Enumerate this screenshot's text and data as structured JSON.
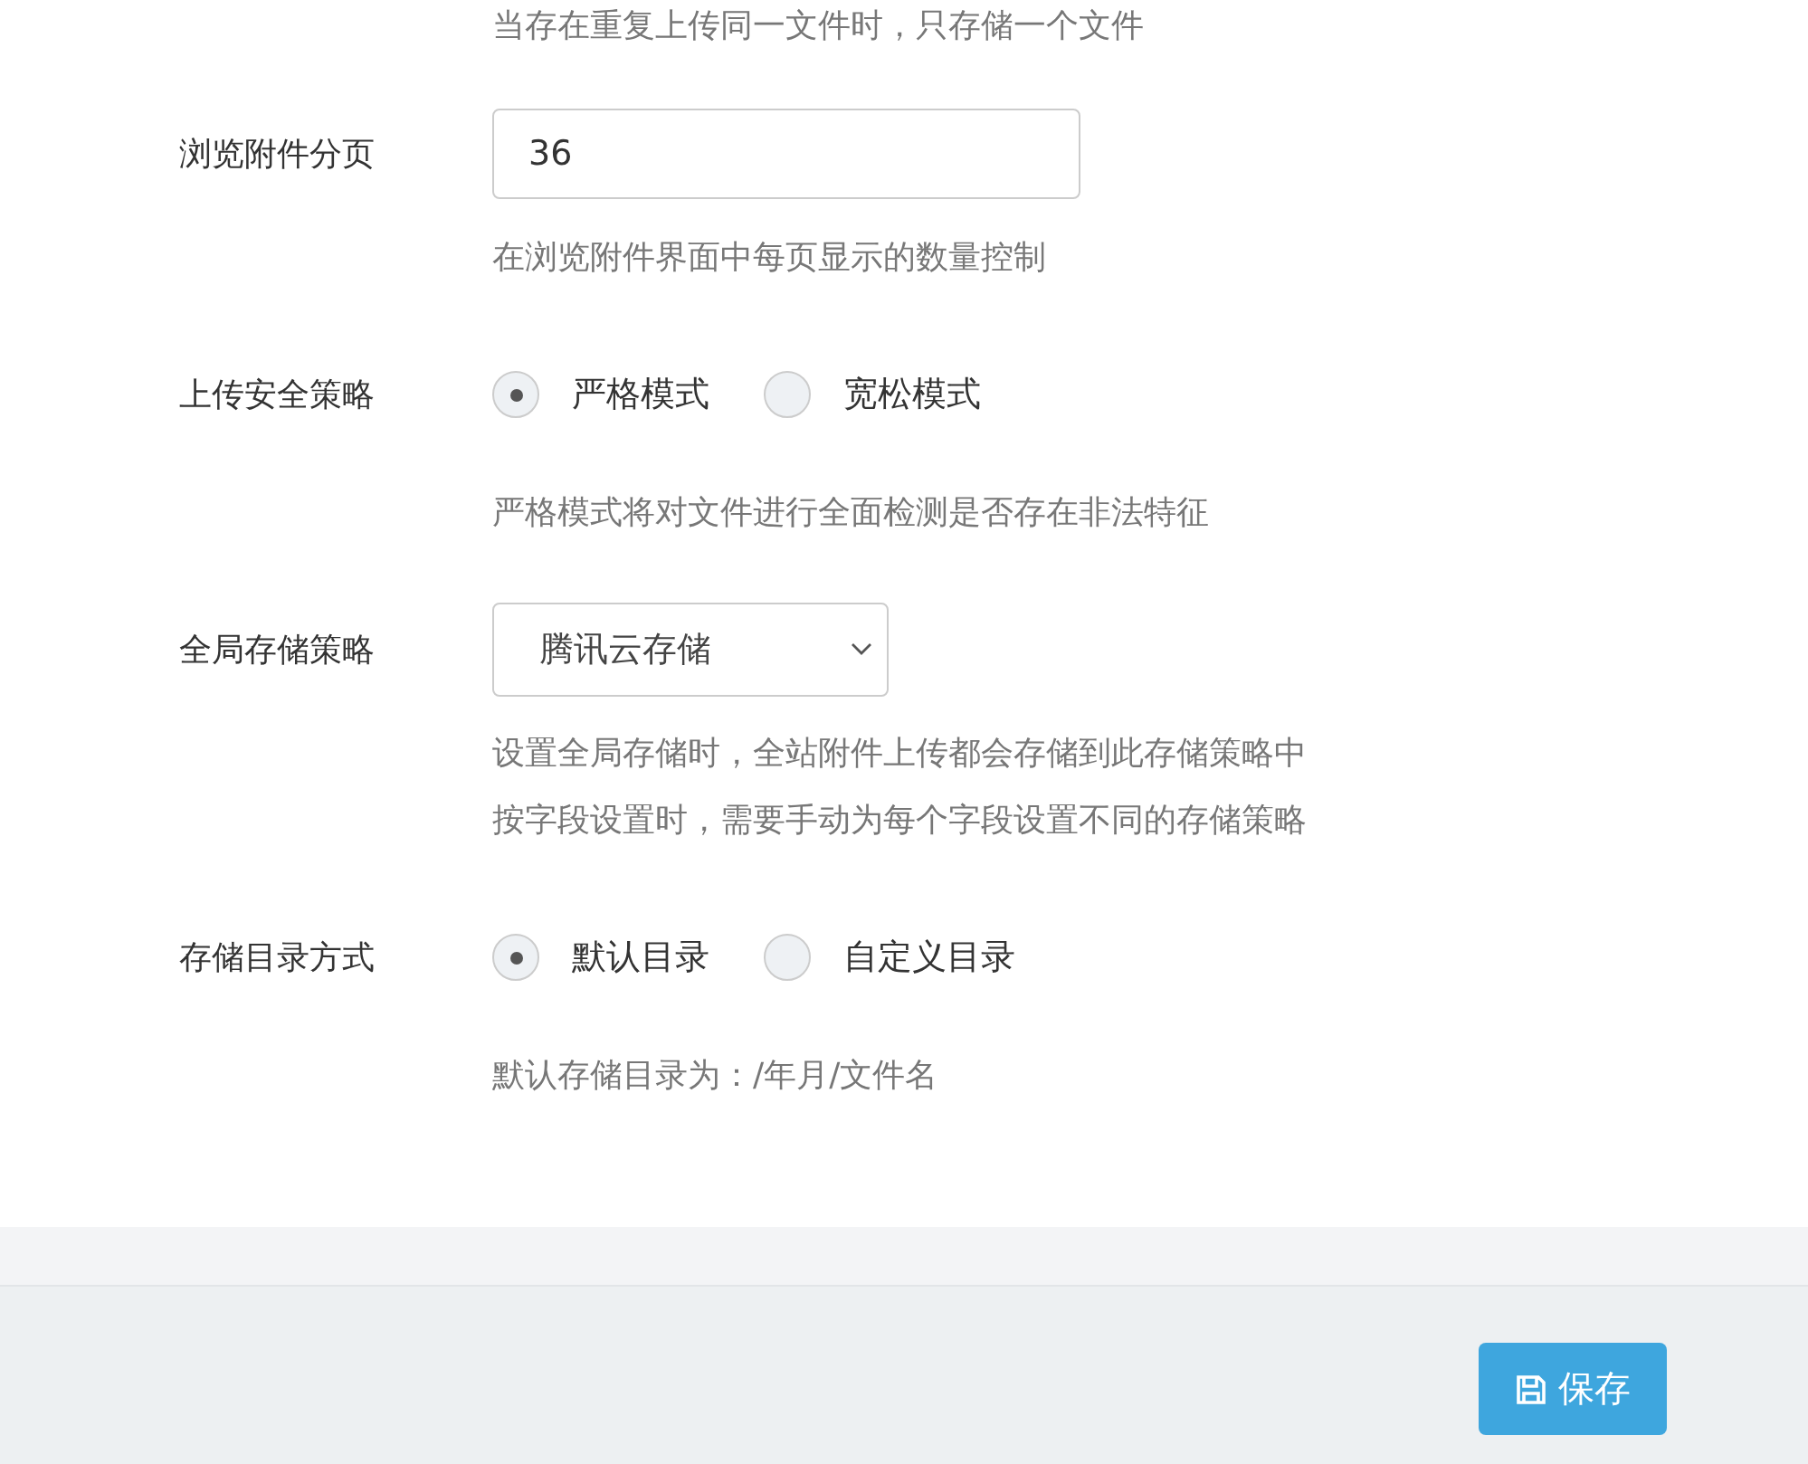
{
  "top_help": "当存在重复上传同一文件时，只存储一个文件",
  "fields": [
    {
      "kind": "text",
      "label": "浏览附件分页",
      "value": "36",
      "help": [
        "在浏览附件界面中每页显示的数量控制"
      ]
    },
    {
      "kind": "radio",
      "label": "上传安全策略",
      "options": [
        {
          "label": "严格模式",
          "selected": true
        },
        {
          "label": "宽松模式",
          "selected": false
        }
      ],
      "help": [
        "严格模式将对文件进行全面检测是否存在非法特征"
      ]
    },
    {
      "kind": "select",
      "label": "全局存储策略",
      "value": "腾讯云存储",
      "help": [
        "设置全局存储时，全站附件上传都会存储到此存储策略中",
        "按字段设置时，需要手动为每个字段设置不同的存储策略"
      ]
    },
    {
      "kind": "radio",
      "label": "存储目录方式",
      "options": [
        {
          "label": "默认目录",
          "selected": true
        },
        {
          "label": "自定义目录",
          "selected": false
        }
      ],
      "help": [
        "默认存储目录为：/年月/文件名"
      ]
    }
  ],
  "save_button": "保存"
}
